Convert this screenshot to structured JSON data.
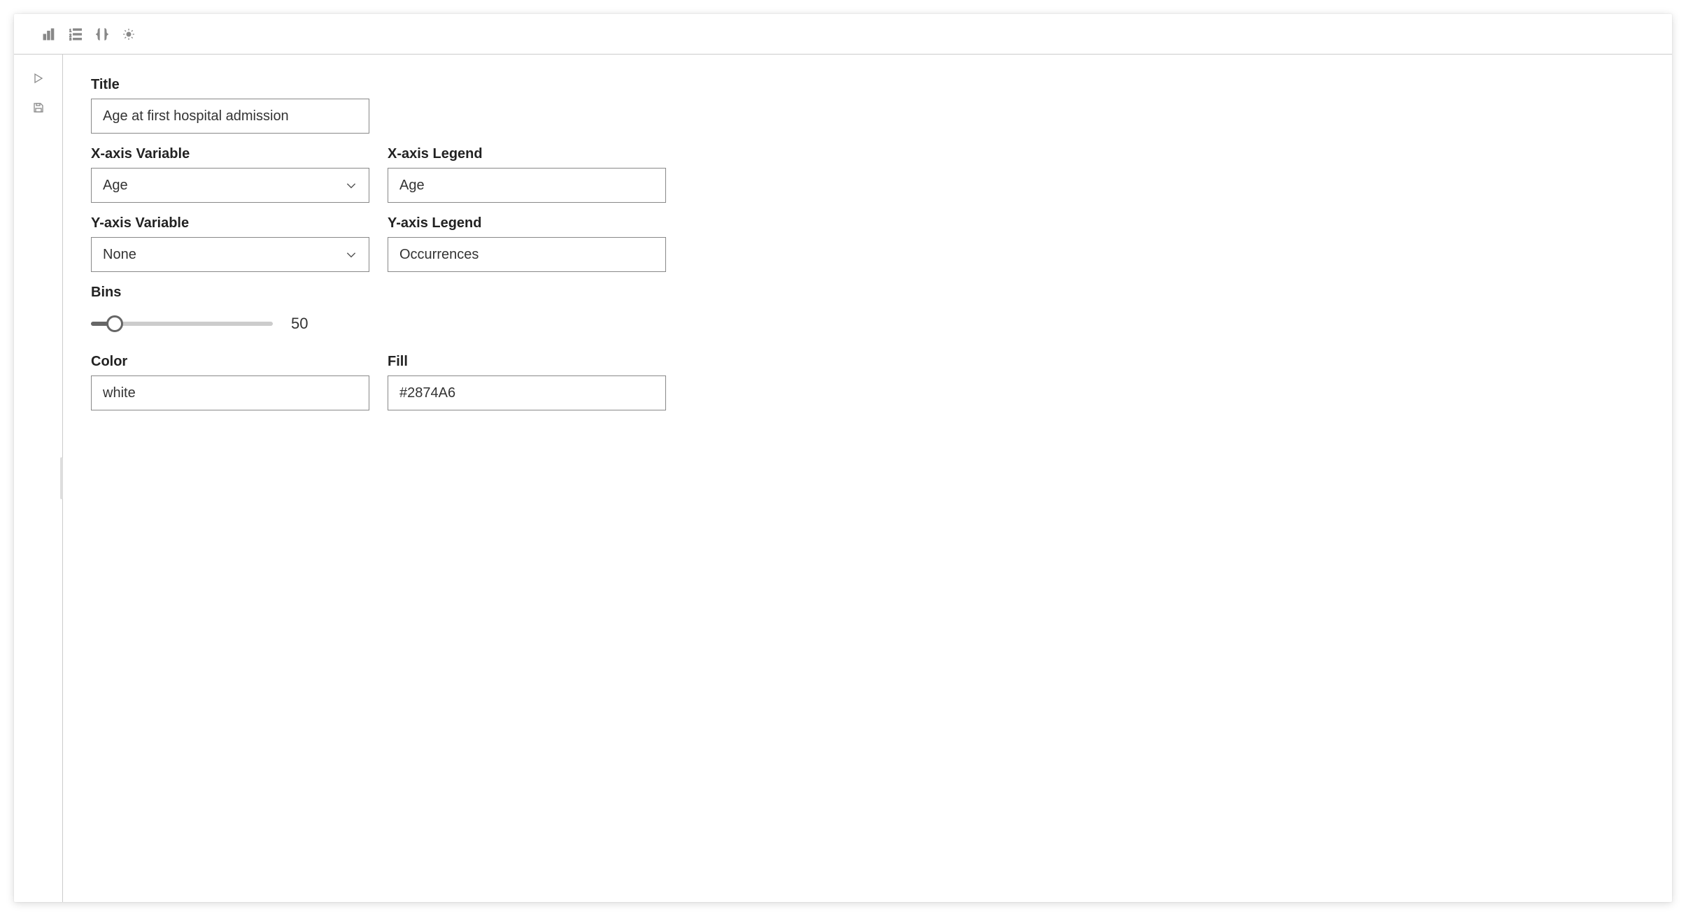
{
  "form": {
    "title_label": "Title",
    "title_value": "Age at first hospital admission",
    "x_var_label": "X-axis Variable",
    "x_var_value": "Age",
    "x_legend_label": "X-axis Legend",
    "x_legend_value": "Age",
    "y_var_label": "Y-axis Variable",
    "y_var_value": "None",
    "y_legend_label": "Y-axis Legend",
    "y_legend_value": "Occurrences",
    "bins_label": "Bins",
    "bins_value": "50",
    "color_label": "Color",
    "color_value": "white",
    "fill_label": "Fill",
    "fill_value": "#2874A6"
  }
}
